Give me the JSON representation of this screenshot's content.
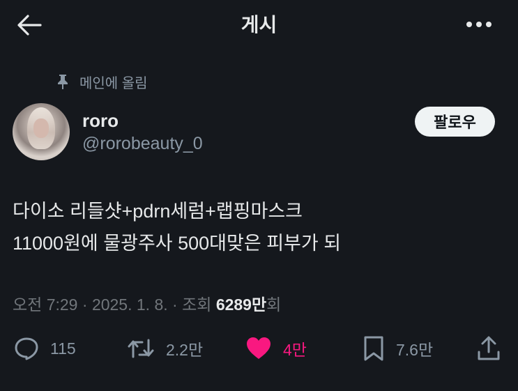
{
  "header": {
    "title": "게시"
  },
  "pinned": {
    "label": "메인에 올림"
  },
  "author": {
    "name": "roro",
    "handle": "@rorobeauty_0"
  },
  "follow_button": {
    "label": "팔로우"
  },
  "post": {
    "lines": [
      "다이소 리들샷+pdrn세럼+랩핑마스크",
      "11000원에 물광주사 500대맞은 피부가 되"
    ]
  },
  "meta": {
    "time": "오전 7:29",
    "separator": "·",
    "date": "2025. 1. 8.",
    "views_label": "조회",
    "views_count": "6289",
    "views_unit": "만",
    "views_suffix": "회"
  },
  "actions": {
    "reply_count": "115",
    "retweet_count": "2.2만",
    "like_count": "4만",
    "bookmark_count": "7.6만"
  },
  "colors": {
    "background": "#15181d",
    "like": "#f91880",
    "muted": "#8b98a5"
  }
}
